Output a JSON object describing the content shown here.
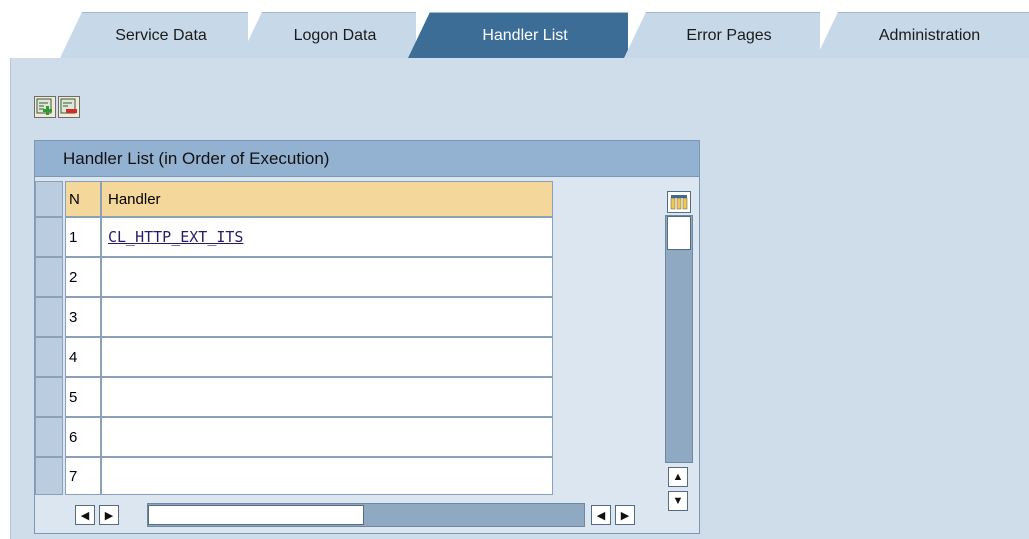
{
  "tabs": [
    {
      "label": "Service Data",
      "active": false
    },
    {
      "label": "Logon Data",
      "active": false
    },
    {
      "label": "Handler List",
      "active": true
    },
    {
      "label": "Error Pages",
      "active": false
    },
    {
      "label": "Administration",
      "active": false
    }
  ],
  "toolbar": {
    "insert_row_icon": "insert-row-icon",
    "delete_row_icon": "delete-row-icon"
  },
  "panel": {
    "title": "Handler List (in Order of Execution)",
    "columns": {
      "number": "N",
      "handler": "Handler"
    },
    "rows": [
      {
        "n": "1",
        "handler": "CL_HTTP_EXT_ITS"
      },
      {
        "n": "2",
        "handler": ""
      },
      {
        "n": "3",
        "handler": ""
      },
      {
        "n": "4",
        "handler": ""
      },
      {
        "n": "5",
        "handler": ""
      },
      {
        "n": "6",
        "handler": ""
      },
      {
        "n": "7",
        "handler": ""
      }
    ]
  },
  "colors": {
    "active_tab": "#3b6d97",
    "inactive_tab": "#c7d8e9",
    "panel_title_bg": "#93b2d2",
    "header_row_bg": "#f3d79b",
    "background": "#cfdcea"
  }
}
